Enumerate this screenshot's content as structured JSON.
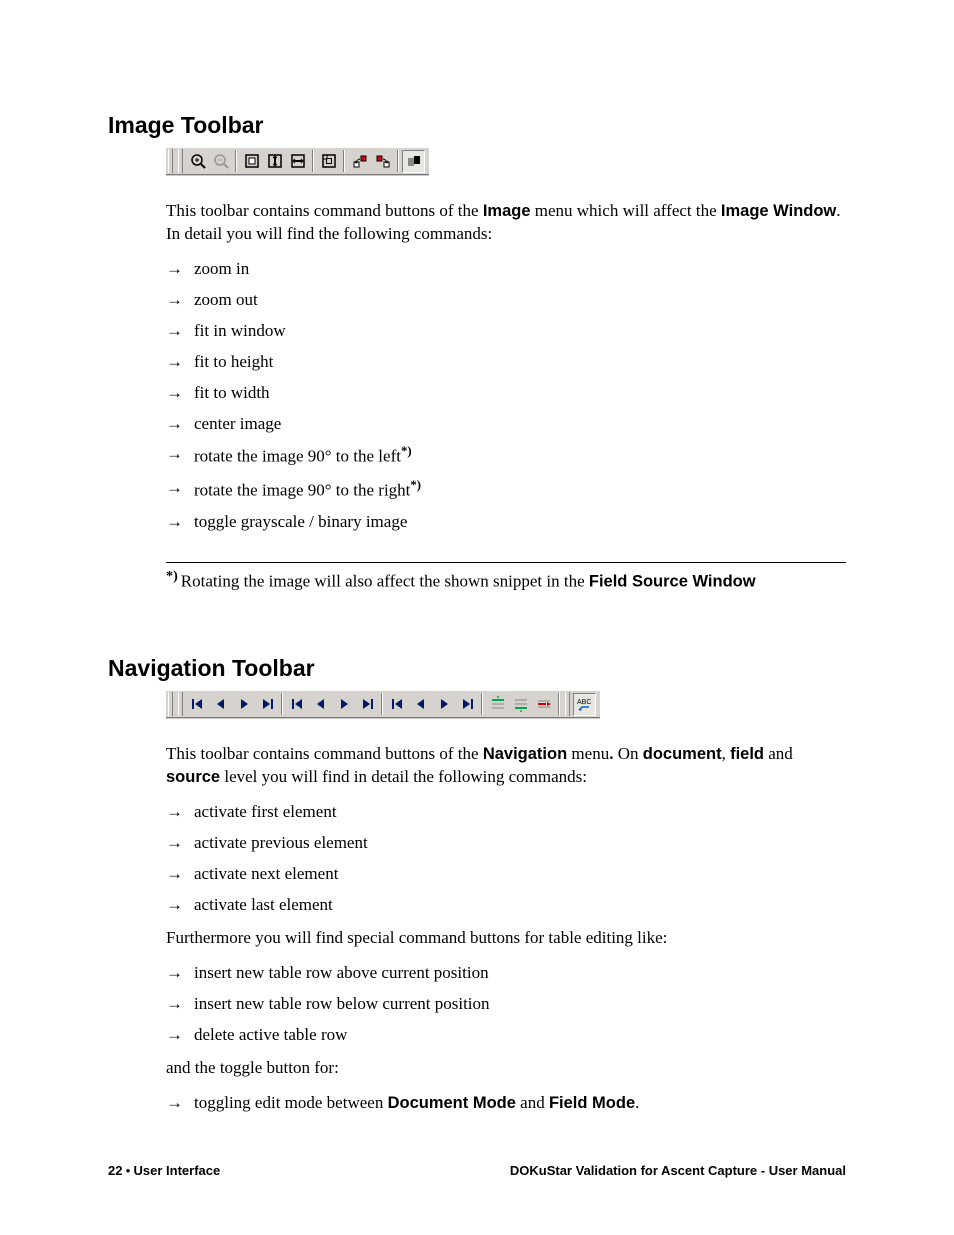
{
  "section1": {
    "heading": "Image Toolbar",
    "intro_pre": "This toolbar contains command buttons of the ",
    "intro_b1": "Image",
    "intro_mid": " menu which will affect the ",
    "intro_b2": "Image Window",
    "intro_post": ". In detail you will find the following commands:",
    "items": [
      "zoom in",
      "zoom out",
      "fit in window",
      "fit to height",
      "fit to width",
      "center image",
      "rotate the image 90° to the left",
      "rotate the image 90° to the right",
      "toggle grayscale / binary image"
    ],
    "star": "*)",
    "footnote_pre": "Rotating the image will also affect the shown snippet in the ",
    "footnote_b": "Field Source Window"
  },
  "section2": {
    "heading": "Navigation Toolbar",
    "intro_pre": "This toolbar contains command buttons of the ",
    "intro_b1": "Navigation",
    "intro_mid1": " menu",
    "intro_dot": ".",
    "intro_mid2": " On ",
    "intro_b2": "document",
    "intro_mid3": ", ",
    "intro_b3": "field",
    "intro_mid4": "  and ",
    "intro_b4": "source",
    "intro_post": " level you will find in detail the following commands:",
    "items1": [
      "activate first element",
      "activate previous element",
      "activate next element",
      "activate last element"
    ],
    "para2": "Furthermore you will find special command buttons for table editing like:",
    "items2": [
      "insert new table row above current position",
      "insert new table row below current position",
      "delete active table row"
    ],
    "para3": "and the toggle button for:",
    "item3_pre": "toggling edit mode between ",
    "item3_b1": "Document Mode",
    "item3_mid": " and ",
    "item3_b2": "Field Mode",
    "item3_post": "."
  },
  "footer": {
    "page": "22",
    "sep": "  •  ",
    "section": "User Interface",
    "right": "DOKuStar Validation for Ascent Capture -  User Manual"
  }
}
